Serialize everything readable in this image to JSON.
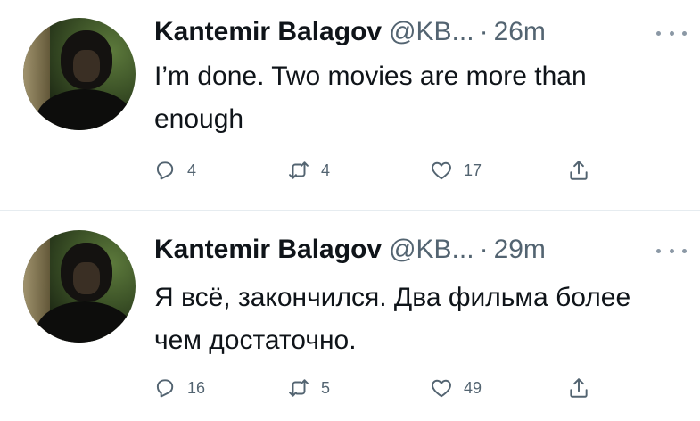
{
  "tweets": [
    {
      "name": "Kantemir Balagov",
      "handle": "@KB...",
      "separator": "·",
      "time": "26m",
      "text": "I’m done. Two movies are more than enough",
      "replies": "4",
      "retweets": "4",
      "likes": "17"
    },
    {
      "name": "Kantemir Balagov",
      "handle": "@KB...",
      "separator": "·",
      "time": "29m",
      "text": "Я всё, закончился. Два фильма более чем достаточно.",
      "replies": "16",
      "retweets": "5",
      "likes": "49"
    }
  ],
  "icons": {
    "reply": "reply-icon",
    "retweet": "retweet-icon",
    "like": "heart-icon",
    "share": "share-icon",
    "more": "more-icon"
  },
  "colors": {
    "text": "#0f1419",
    "secondary": "#536471",
    "divider": "#e6ecf0"
  }
}
